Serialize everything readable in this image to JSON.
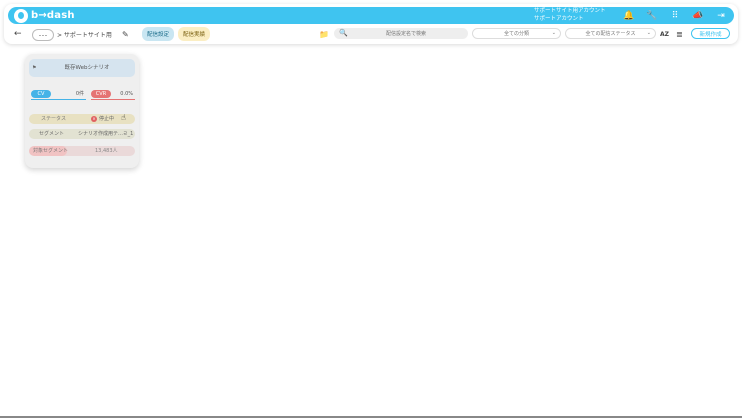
{
  "app": {
    "logo_text": "b→dash",
    "account_line1": "サポートサイト用アカウント",
    "account_line2": "サポートアカウント"
  },
  "top_icons": [
    {
      "icon": "bell-icon",
      "glyph": "🔔"
    },
    {
      "icon": "wrench-icon",
      "glyph": "🔧"
    },
    {
      "icon": "grid-icon",
      "glyph": "⠿"
    },
    {
      "icon": "megaphone-icon",
      "glyph": "📣"
    },
    {
      "icon": "logout-icon",
      "glyph": "⇥"
    }
  ],
  "toolbar": {
    "back": "←",
    "ellipsis": "･･･",
    "breadcrumb": "> サポートサイト用",
    "edit_glyph": "✎",
    "tabs": [
      {
        "label": "配信設定"
      },
      {
        "label": "配信実績"
      }
    ],
    "folder_glyph": "📁",
    "search_glyph": "🔍",
    "search_placeholder": "配信設定名で検索",
    "filter_category": "全ての分類",
    "filter_status": "全ての配信ステータス",
    "caret": "⌄",
    "sort_glyph": "AZ",
    "list_glyph": "≣",
    "new_button": "新規作成"
  },
  "card": {
    "flag": "⚑",
    "title": "既存Webシナリオ",
    "cv_label": "CV",
    "cv_value": "0件",
    "cvr_label": "CVR",
    "cvr_value": "0.0%",
    "status_label": "ステータス",
    "status_dot": "×",
    "status_value": "停止中",
    "cursor_glyph": "☝",
    "segment_label": "セグメント",
    "segment_value": "シナリオ作成用テ…ㄹ_1",
    "target_label": "対象セグメント",
    "target_value": "13,483人",
    "target_fill": 0.36
  },
  "colors": {
    "brand": "#3fc4f0",
    "cv": "#45b3e7",
    "cvr": "#e57373"
  }
}
